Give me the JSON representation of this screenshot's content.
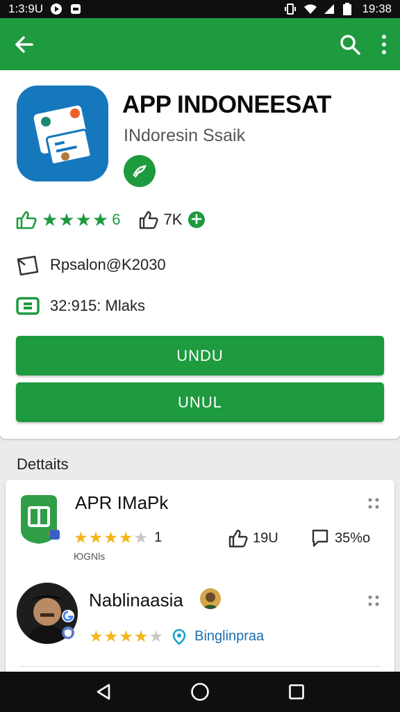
{
  "status_bar": {
    "time": "1:3:9U",
    "right_time": "19:38",
    "icons": [
      "play-circle-icon",
      "notification-icon",
      "vibrate-icon",
      "wifi-icon",
      "signal-icon",
      "battery-icon"
    ]
  },
  "app_bar": {
    "back_icon": "arrow-back-icon",
    "search_icon": "search-icon",
    "more_icon": "more-vert-icon",
    "color": "#1e9a3f"
  },
  "app": {
    "title": "APP INDONEESAT",
    "developer": "INdoresin Ssaik",
    "rating_value": "6",
    "likes": "7K",
    "email": "Rpsalon@K2030",
    "installs": "32:915: Mlaks",
    "primary_button": "UNDU",
    "secondary_button": "UNUL",
    "accent": "#1e9a3f"
  },
  "details": {
    "section_title": "Dettaits",
    "items": [
      {
        "title": "APR IMaPk",
        "rating_count": "1",
        "likes": "19U",
        "comments": "35%o",
        "sub": "ЮGNls",
        "stars": 4.5
      },
      {
        "title": "Nablinaasia",
        "location": "Binglinpraa",
        "stars": 4
      }
    ]
  },
  "nav": {
    "back": "nav-back-icon",
    "home": "nav-home-icon",
    "recents": "nav-recents-icon"
  }
}
